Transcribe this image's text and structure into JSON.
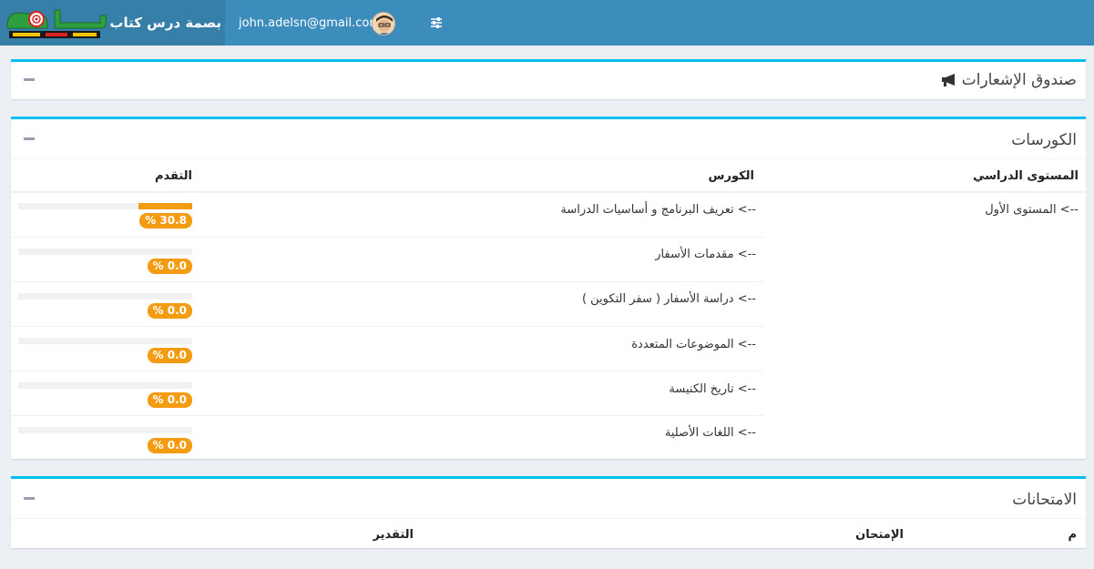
{
  "header": {
    "brand": "بصمة درس كتاب",
    "logo_text": "بصمة",
    "user_email": "john.adelsn@gmail.com",
    "settings_icon": "sliders-icon"
  },
  "notifications": {
    "title": "صندوق الإشعارات",
    "icon": "megaphone-icon"
  },
  "courses": {
    "title": "الكورسات",
    "columns": {
      "level": "المستوى الدراسي",
      "course": "الكورس",
      "progress": "التقدم"
    },
    "level_value": "--> المستوى الأول",
    "rows": [
      {
        "course": "--> تعريف البرنامج و أساسيات الدراسة",
        "progress": 30.8,
        "label": "30.8 %"
      },
      {
        "course": "--> مقدمات الأسفار",
        "progress": 0,
        "label": "0.0 %"
      },
      {
        "course": "--> دراسة الأسفار ( سفر التكوين )",
        "progress": 0,
        "label": "0.0 %"
      },
      {
        "course": "--> الموضوعات المتعددة",
        "progress": 0,
        "label": "0.0 %"
      },
      {
        "course": "--> تاريخ الكنيسة",
        "progress": 0,
        "label": "0.0 %"
      },
      {
        "course": "--> اللغات الأصلية",
        "progress": 0,
        "label": "0.0 %"
      }
    ]
  },
  "exams": {
    "title": "الامتحانات",
    "columns": {
      "num": "م",
      "exam": "الإمتحان",
      "grade": "التقدير"
    }
  },
  "colors": {
    "topbar": "#3c8dbc",
    "accent": "#00c0ef",
    "warning": "#f39c12"
  }
}
